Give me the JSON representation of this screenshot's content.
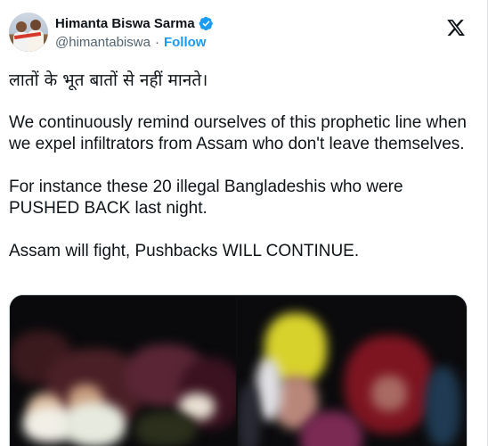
{
  "author": {
    "name": "Himanta Biswa Sarma",
    "handle": "@himantabiswa",
    "follow_label": "Follow",
    "verified": true
  },
  "tweet": {
    "paragraphs": [
      "लातों के भूत बातों से नहीं मानते।",
      "We continuously remind ourselves of this prophetic line when we expel infiltrators from Assam who don't leave themselves.",
      "For instance these 20 illegal Bangladeshis who were PUSHED BACK last night.",
      "Assam will fight, Pushbacks WILL CONTINUE."
    ]
  },
  "media": {
    "photos": [
      "night-photo-group-left",
      "night-photo-group-right"
    ]
  },
  "colors": {
    "accent": "#1d9bf0",
    "text": "#0f1419",
    "secondary": "#536471"
  },
  "icons": {
    "verified": "verified-badge-icon",
    "platform": "x-logo-icon"
  }
}
